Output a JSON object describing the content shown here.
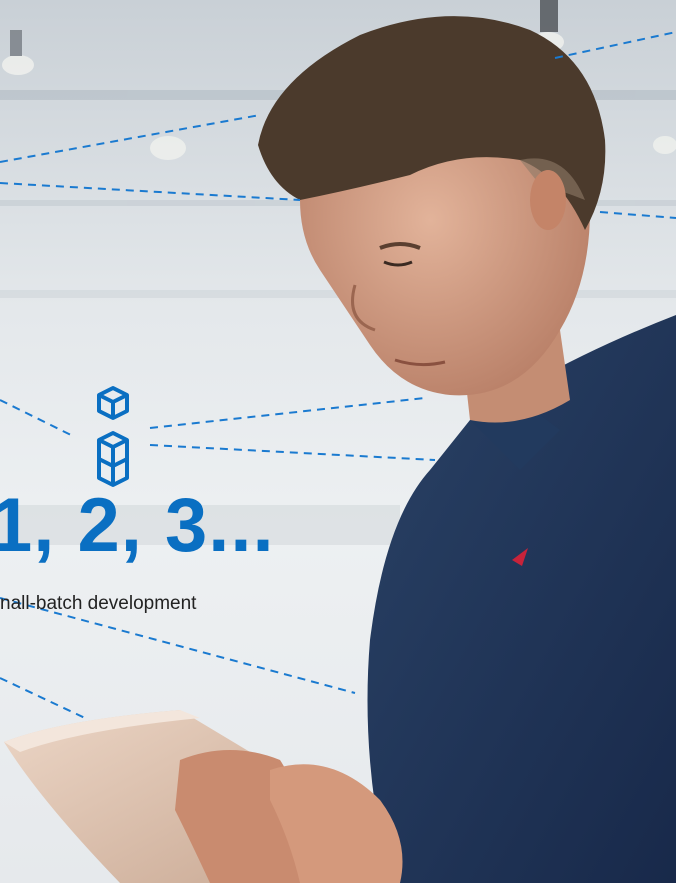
{
  "headline": "1, 2, 3...",
  "caption": "nall-batch development",
  "colors": {
    "accent": "#0a6fc2",
    "shirt": "#1f3556",
    "background": "#dfe4e8"
  },
  "icons": [
    "cube-icon",
    "stacked-cubes-icon"
  ]
}
